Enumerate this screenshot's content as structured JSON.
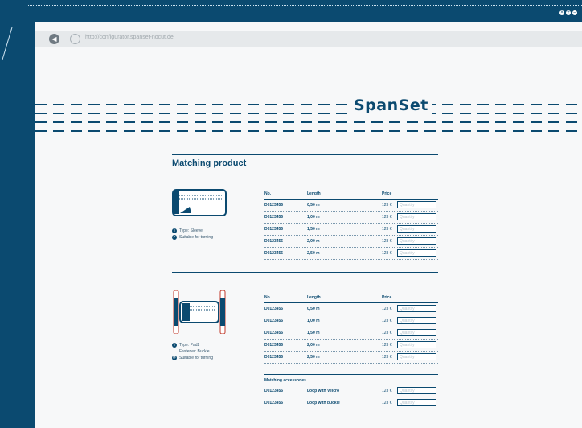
{
  "browser": {
    "url": "http://configurator.spanset-nocut.de",
    "window_controls": [
      "close-icon",
      "maximize-icon",
      "minimize-icon"
    ]
  },
  "brand": {
    "logo_text": "SpanSet",
    "color": "#0b4a70"
  },
  "section": {
    "title": "Matching product"
  },
  "table_headers": {
    "no": "No.",
    "length": "Length",
    "price": "Price"
  },
  "quantity_placeholder": "Quantity",
  "products": [
    {
      "meta_lines": [
        "Type: Sleeve",
        "Suitable for turning"
      ],
      "rows": [
        {
          "no": "D0123456",
          "length": "0,50 m",
          "price": "123 €"
        },
        {
          "no": "D0123456",
          "length": "1,00 m",
          "price": "123 €"
        },
        {
          "no": "D0123456",
          "length": "1,50 m",
          "price": "123 €"
        },
        {
          "no": "D0123456",
          "length": "2,00 m",
          "price": "123 €"
        },
        {
          "no": "D0123456",
          "length": "2,50 m",
          "price": "123 €"
        }
      ]
    },
    {
      "meta_lines": [
        "Type: Pad2",
        "Fastener: Buckle",
        "Suitable for turning"
      ],
      "rows": [
        {
          "no": "D0123456",
          "length": "0,50 m",
          "price": "123 €"
        },
        {
          "no": "D0123456",
          "length": "1,00 m",
          "price": "123 €"
        },
        {
          "no": "D0123456",
          "length": "1,50 m",
          "price": "123 €"
        },
        {
          "no": "D0123456",
          "length": "2,00 m",
          "price": "123 €"
        },
        {
          "no": "D0123456",
          "length": "2,50 m",
          "price": "123 €"
        }
      ],
      "accessories_title": "Matching accessories",
      "accessories": [
        {
          "no": "D0123456",
          "name": "Loop with Velcro",
          "price": "123 €"
        },
        {
          "no": "D0123456",
          "name": "Loop with buckle",
          "price": "123 €"
        }
      ]
    }
  ]
}
